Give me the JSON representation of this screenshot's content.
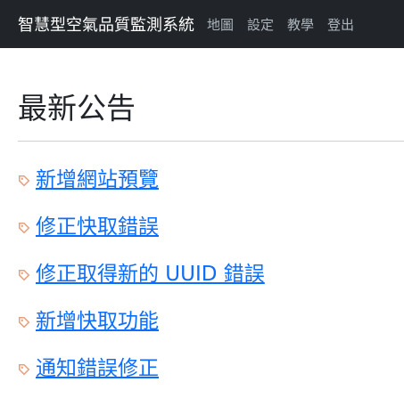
{
  "navbar": {
    "brand": "智慧型空氣品質監測系統",
    "links": [
      {
        "label": "地圖"
      },
      {
        "label": "設定"
      },
      {
        "label": "教學"
      },
      {
        "label": "登出"
      }
    ]
  },
  "main": {
    "title": "最新公告",
    "announcements": [
      {
        "label": "新增網站預覽",
        "icon": "tag-icon"
      },
      {
        "label": "修正快取錯誤",
        "icon": "tag-icon"
      },
      {
        "label": "修正取得新的 UUID 錯誤",
        "icon": "tag-icon"
      },
      {
        "label": "新增快取功能",
        "icon": "tag-icon"
      },
      {
        "label": "通知錯誤修正",
        "icon": "tag-icon"
      }
    ]
  },
  "colors": {
    "navbar_bg": "#212529",
    "link": "#0d6efd",
    "tag_icon": "#e8a17d"
  }
}
